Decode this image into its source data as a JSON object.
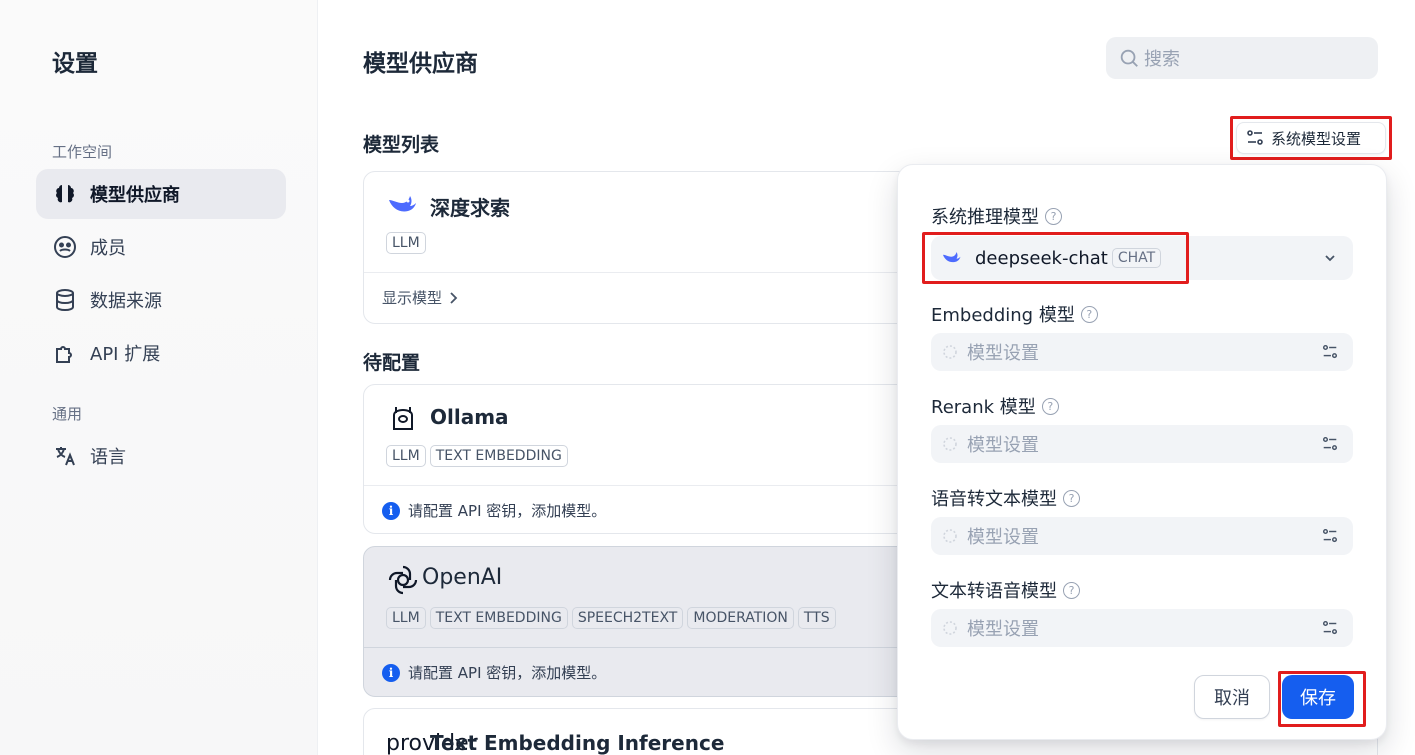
{
  "sidebar": {
    "title": "设置",
    "workspace_label": "工作空间",
    "general_label": "通用",
    "items": [
      {
        "label": "模型供应商"
      },
      {
        "label": "成员"
      },
      {
        "label": "数据来源"
      },
      {
        "label": "API 扩展"
      },
      {
        "label": "语言"
      }
    ]
  },
  "main": {
    "title": "模型供应商",
    "search_placeholder": "搜索",
    "model_list_label": "模型列表",
    "pending_label": "待配置",
    "system_model_button": "系统模型设置"
  },
  "providers": [
    {
      "name": "深度求索",
      "tags": [
        "LLM"
      ],
      "footer": "显示模型"
    },
    {
      "name": "Ollama",
      "tags": [
        "LLM",
        "TEXT EMBEDDING"
      ],
      "footer": "请配置 API 密钥，添加模型。"
    },
    {
      "name": "OpenAI",
      "tags": [
        "LLM",
        "TEXT EMBEDDING",
        "SPEECH2TEXT",
        "MODERATION",
        "TTS"
      ],
      "footer": "请配置 API 密钥，添加模型。"
    },
    {
      "name": "Text Embedding Inference",
      "overlap_text": "provider"
    }
  ],
  "popover": {
    "reasoning_label": "系统推理模型",
    "reasoning_value": "deepseek-chat",
    "reasoning_tag": "CHAT",
    "embedding_label": "Embedding 模型",
    "rerank_label": "Rerank 模型",
    "stt_label": "语音转文本模型",
    "tts_label": "文本转语音模型",
    "placeholder": "模型设置",
    "cancel": "取消",
    "save": "保存"
  },
  "colors": {
    "accent": "#155eef",
    "highlight": "#e11d1d"
  }
}
